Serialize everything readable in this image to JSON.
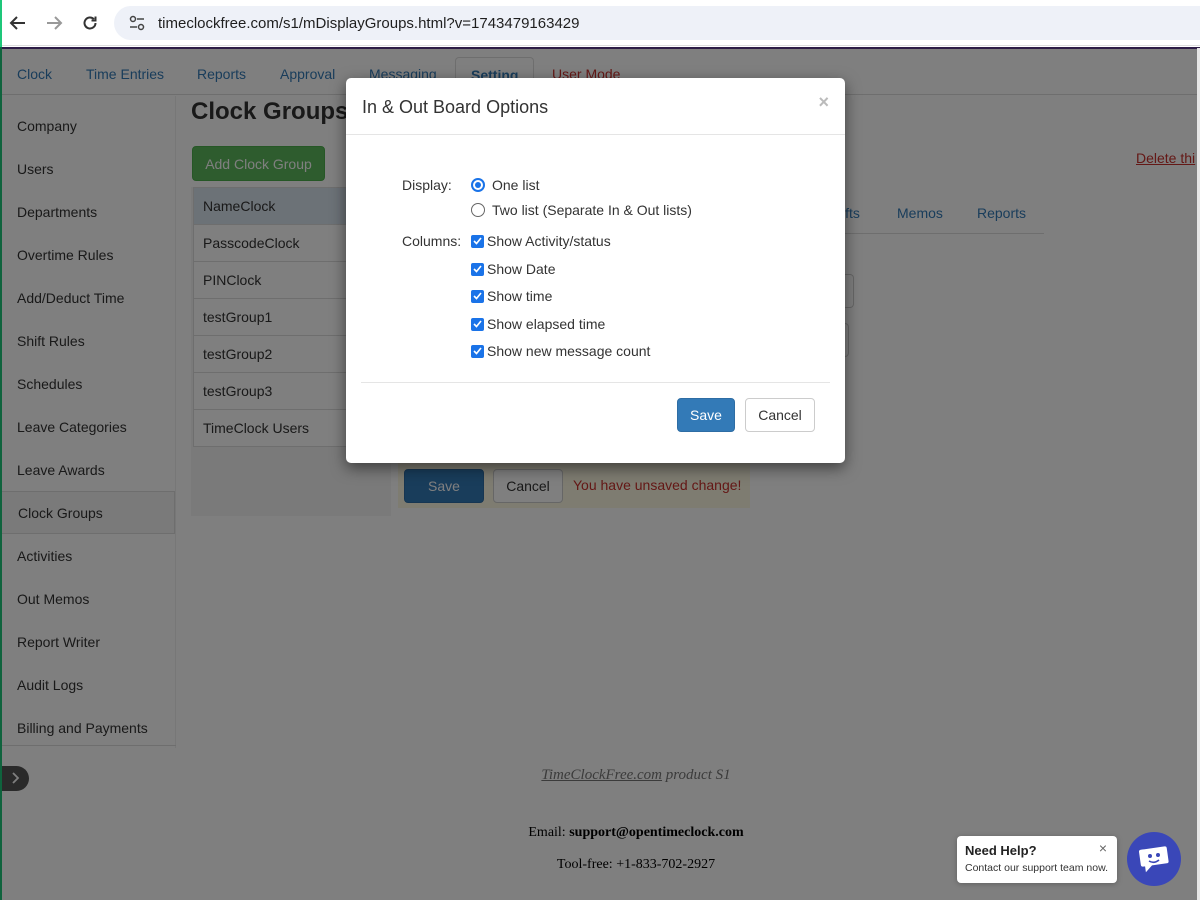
{
  "browser": {
    "url": "timeclockfree.com/s1/mDisplayGroups.html?v=1743479163429"
  },
  "nav": {
    "tabs": [
      {
        "label": "Clock"
      },
      {
        "label": "Time Entries"
      },
      {
        "label": "Reports"
      },
      {
        "label": "Approval"
      },
      {
        "label": "Messaging"
      },
      {
        "label": "Setting"
      },
      {
        "label": "User Mode"
      }
    ]
  },
  "sidebar": {
    "items": [
      {
        "label": "Company"
      },
      {
        "label": "Users"
      },
      {
        "label": "Departments"
      },
      {
        "label": "Overtime Rules"
      },
      {
        "label": "Add/Deduct Time"
      },
      {
        "label": "Shift Rules"
      },
      {
        "label": "Schedules"
      },
      {
        "label": "Leave Categories"
      },
      {
        "label": "Leave Awards"
      },
      {
        "label": "Clock Groups"
      },
      {
        "label": "Activities"
      },
      {
        "label": "Out Memos"
      },
      {
        "label": "Report Writer"
      },
      {
        "label": "Audit Logs"
      },
      {
        "label": "Billing and Payments"
      }
    ]
  },
  "main": {
    "title": "Clock Groups",
    "add_button": "Add Clock Group",
    "delete_link": "Delete thi",
    "groups": [
      {
        "label": "NameClock"
      },
      {
        "label": "PasscodeClock"
      },
      {
        "label": "PINClock"
      },
      {
        "label": "testGroup1"
      },
      {
        "label": "testGroup2"
      },
      {
        "label": "testGroup3"
      },
      {
        "label": "TimeClock Users"
      }
    ],
    "right_tabs": [
      {
        "label": "ifts"
      },
      {
        "label": "Memos"
      },
      {
        "label": "Reports"
      }
    ],
    "save": "Save",
    "cancel": "Cancel",
    "unsaved": "You have unsaved change!"
  },
  "footer": {
    "product_link": "TimeClockFree.com",
    "product_suffix": " product S1",
    "email_label": "Email: ",
    "email": "support@opentimeclock.com",
    "phone": "Tool-free: +1-833-702-2927"
  },
  "modal": {
    "title": "In & Out Board Options",
    "close": "×",
    "display_label": "Display:",
    "display_options": [
      {
        "label": "One list",
        "checked": true
      },
      {
        "label": "Two list (Separate In & Out lists)",
        "checked": false
      }
    ],
    "columns_label": "Columns:",
    "columns": [
      {
        "label": "Show Activity/status",
        "checked": true
      },
      {
        "label": "Show Date",
        "checked": true
      },
      {
        "label": "Show time",
        "checked": true
      },
      {
        "label": "Show elapsed time",
        "checked": true
      },
      {
        "label": "Show new message count",
        "checked": true
      }
    ],
    "save": "Save",
    "cancel": "Cancel"
  },
  "help": {
    "title": "Need Help?",
    "subtitle": "Contact our support team now.",
    "close": "×"
  },
  "colors": {
    "accent": "#337ab7",
    "success": "#5cb85c",
    "danger": "#c9302c",
    "checkbox": "#1a73e8",
    "chat": "#3a47b8"
  }
}
